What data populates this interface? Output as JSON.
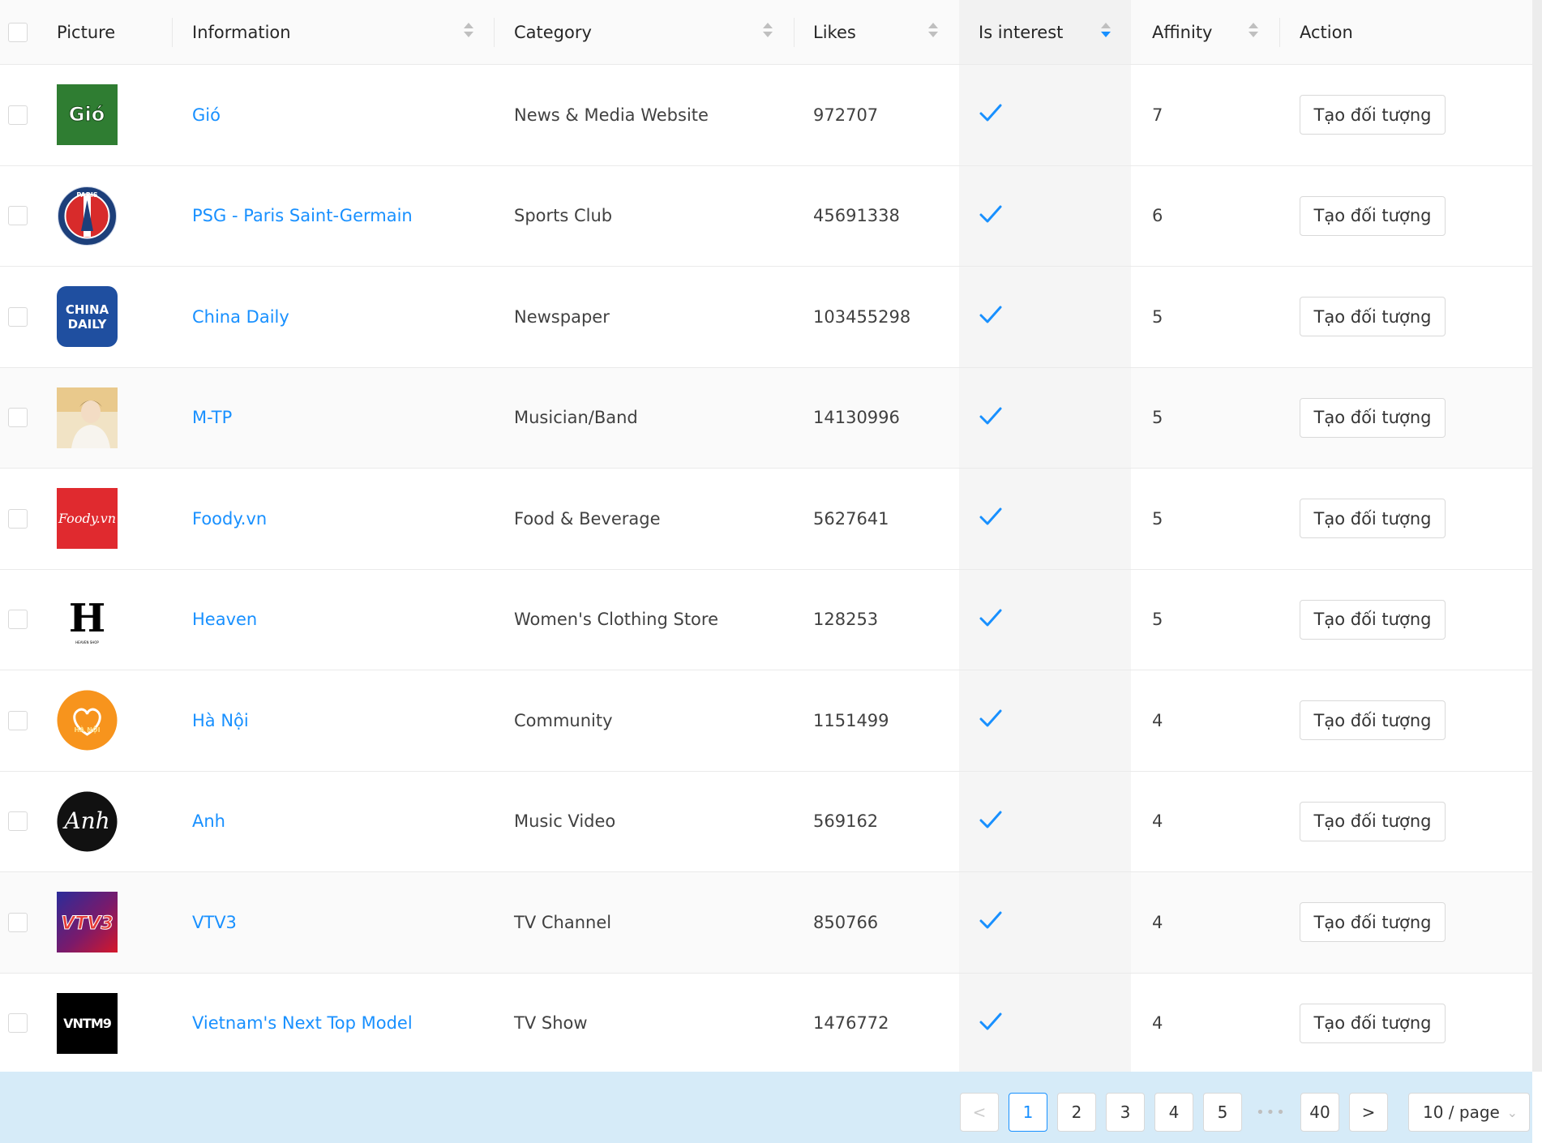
{
  "header": {
    "picture": "Picture",
    "information": "Information",
    "category": "Category",
    "likes": "Likes",
    "is_interest": "Is interest",
    "affinity": "Affinity",
    "action": "Action"
  },
  "rows": [
    {
      "name": "Gió",
      "category": "News & Media Website",
      "likes": "972707",
      "is_interest": true,
      "affinity": "7",
      "action": "Tạo đối tượng",
      "logo_text": "Gió",
      "logo_bg": "#2f7d32"
    },
    {
      "name": "PSG - Paris Saint-Germain",
      "category": "Sports Club",
      "likes": "45691338",
      "is_interest": true,
      "affinity": "6",
      "action": "Tạo đối tượng",
      "logo_text": "PARIS",
      "logo_bg": "#1d3f7a"
    },
    {
      "name": "China Daily",
      "category": "Newspaper",
      "likes": "103455298",
      "is_interest": true,
      "affinity": "5",
      "action": "Tạo đối tượng",
      "logo_text": "CHINA DAILY",
      "logo_bg": "#1f4fa0"
    },
    {
      "name": "M-TP",
      "category": "Musician/Band",
      "likes": "14130996",
      "is_interest": true,
      "affinity": "5",
      "action": "Tạo đối tượng",
      "logo_text": "",
      "logo_bg": "#f1e3c5"
    },
    {
      "name": "Foody.vn",
      "category": "Food & Beverage",
      "likes": "5627641",
      "is_interest": true,
      "affinity": "5",
      "action": "Tạo đối tượng",
      "logo_text": "Foody.vn",
      "logo_bg": "#e02a2f"
    },
    {
      "name": "Heaven",
      "category": "Women's Clothing Store",
      "likes": "128253",
      "is_interest": true,
      "affinity": "5",
      "action": "Tạo đối tượng",
      "logo_text": "H",
      "logo_bg": "#ffffff"
    },
    {
      "name": "Hà Nội",
      "category": "Community",
      "likes": "1151499",
      "is_interest": true,
      "affinity": "4",
      "action": "Tạo đối tượng",
      "logo_text": "HÀ NỘI",
      "logo_bg": "#f7941d"
    },
    {
      "name": "Anh",
      "category": "Music Video",
      "likes": "569162",
      "is_interest": true,
      "affinity": "4",
      "action": "Tạo đối tượng",
      "logo_text": "Anh",
      "logo_bg": "#111111"
    },
    {
      "name": "VTV3",
      "category": "TV Channel",
      "likes": "850766",
      "is_interest": true,
      "affinity": "4",
      "action": "Tạo đối tượng",
      "logo_text": "VTV3",
      "logo_bg": "#3b2a8c"
    },
    {
      "name": "Vietnam's Next Top Model",
      "category": "TV Show",
      "likes": "1476772",
      "is_interest": true,
      "affinity": "4",
      "action": "Tạo đối tượng",
      "logo_text": "VNTM9",
      "logo_bg": "#000000"
    }
  ],
  "pagination": {
    "prev": "<",
    "pages": [
      "1",
      "2",
      "3",
      "4",
      "5"
    ],
    "ellipsis": "•••",
    "last": "40",
    "next": ">",
    "current": "1",
    "page_size": "10 / page"
  },
  "colors": {
    "accent": "#1890ff",
    "footer_bg": "#d6ebf8"
  },
  "icons": {
    "checkmark": "check-icon",
    "sort": "sort-icon",
    "prev": "chevron-left-icon",
    "next": "chevron-right-icon",
    "dropdown": "chevron-down-icon"
  }
}
